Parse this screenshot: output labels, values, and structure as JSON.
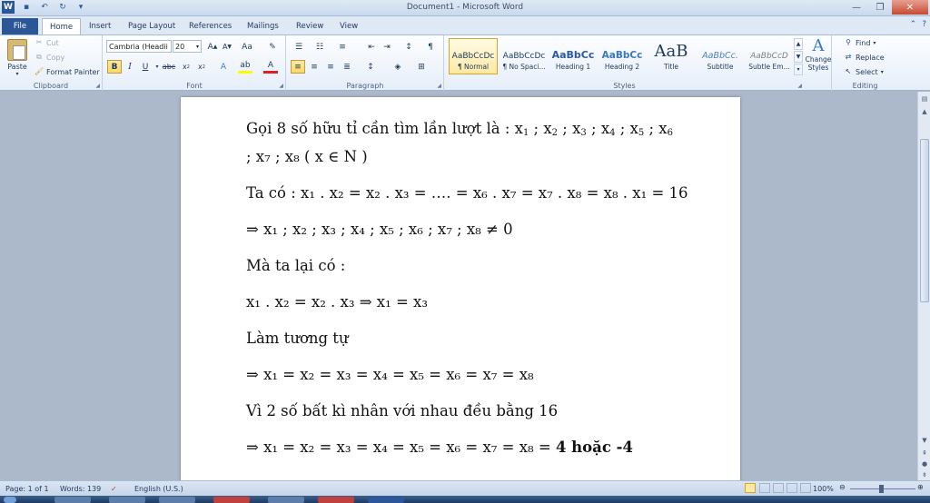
{
  "window": {
    "title": "Document1 - Microsoft Word",
    "logo": "W"
  },
  "tabs": {
    "file": "File",
    "home": "Home",
    "insert": "Insert",
    "page_layout": "Page Layout",
    "references": "References",
    "mailings": "Mailings",
    "review": "Review",
    "view": "View"
  },
  "clipboard": {
    "paste": "Paste",
    "cut": "Cut",
    "copy": "Copy",
    "format_painter": "Format Painter",
    "label": "Clipboard"
  },
  "font": {
    "name": "Cambria (Headii",
    "size": "20",
    "label": "Font"
  },
  "paragraph": {
    "label": "Paragraph"
  },
  "styles": {
    "label": "Styles",
    "items": [
      {
        "preview": "AaBbCcDc",
        "name": "¶ Normal"
      },
      {
        "preview": "AaBbCcDc",
        "name": "¶ No Spaci..."
      },
      {
        "preview": "AaBbCc",
        "name": "Heading 1"
      },
      {
        "preview": "AaBbCc",
        "name": "Heading 2"
      },
      {
        "preview": "AaB",
        "name": "Title"
      },
      {
        "preview": "AaBbCc.",
        "name": "Subtitle"
      },
      {
        "preview": "AaBbCcD",
        "name": "Subtle Em..."
      }
    ],
    "change_styles": "Change Styles",
    "change_styles_line1": "Change",
    "change_styles_line2": "Styles"
  },
  "editing": {
    "label": "Editing",
    "find": "Find",
    "replace": "Replace",
    "select": "Select"
  },
  "document": {
    "p1a": "Gọi 8 số hữu tỉ cần tìm lần lượt là : x",
    "p1b": "; x₇ ; x₈ ( x ∈ N )",
    "p2": "Ta có : x₁ . x₂ = x₂ . x₃ = …. = x₆ . x₇ = x₇ . x₈ = x₈ . x₁ = 16",
    "p3": "⇒ x₁ ; x₂ ; x₃ ; x₄ ; x₅ ; x₆ ; x₇ ; x₈ ≠ 0",
    "p4": "Mà ta lại có :",
    "p5": "x₁ . x₂ = x₂ . x₃ ⇒ x₁ = x₃",
    "p6": "Làm tương tự",
    "p7": "⇒ x₁ = x₂ = x₃ = x₄ = x₅ = x₆ = x₇ = x₈",
    "p8": "Vì 2 số bất kì nhân với nhau đều bằng 16",
    "p9a": "⇒ x₁ = x₂ = x₃ = x₄ = x₅ = x₆ = x₇ = x₈ = ",
    "p9b": "4 hoặc -4"
  },
  "status": {
    "page": "Page: 1 of 1",
    "words": "Words: 139",
    "language": "English (U.S.)",
    "zoom": "100%"
  },
  "colors": {
    "file_tab": "#2b5797",
    "ribbon_bg": "#e6eef9",
    "workspace": "#abb9cb"
  }
}
